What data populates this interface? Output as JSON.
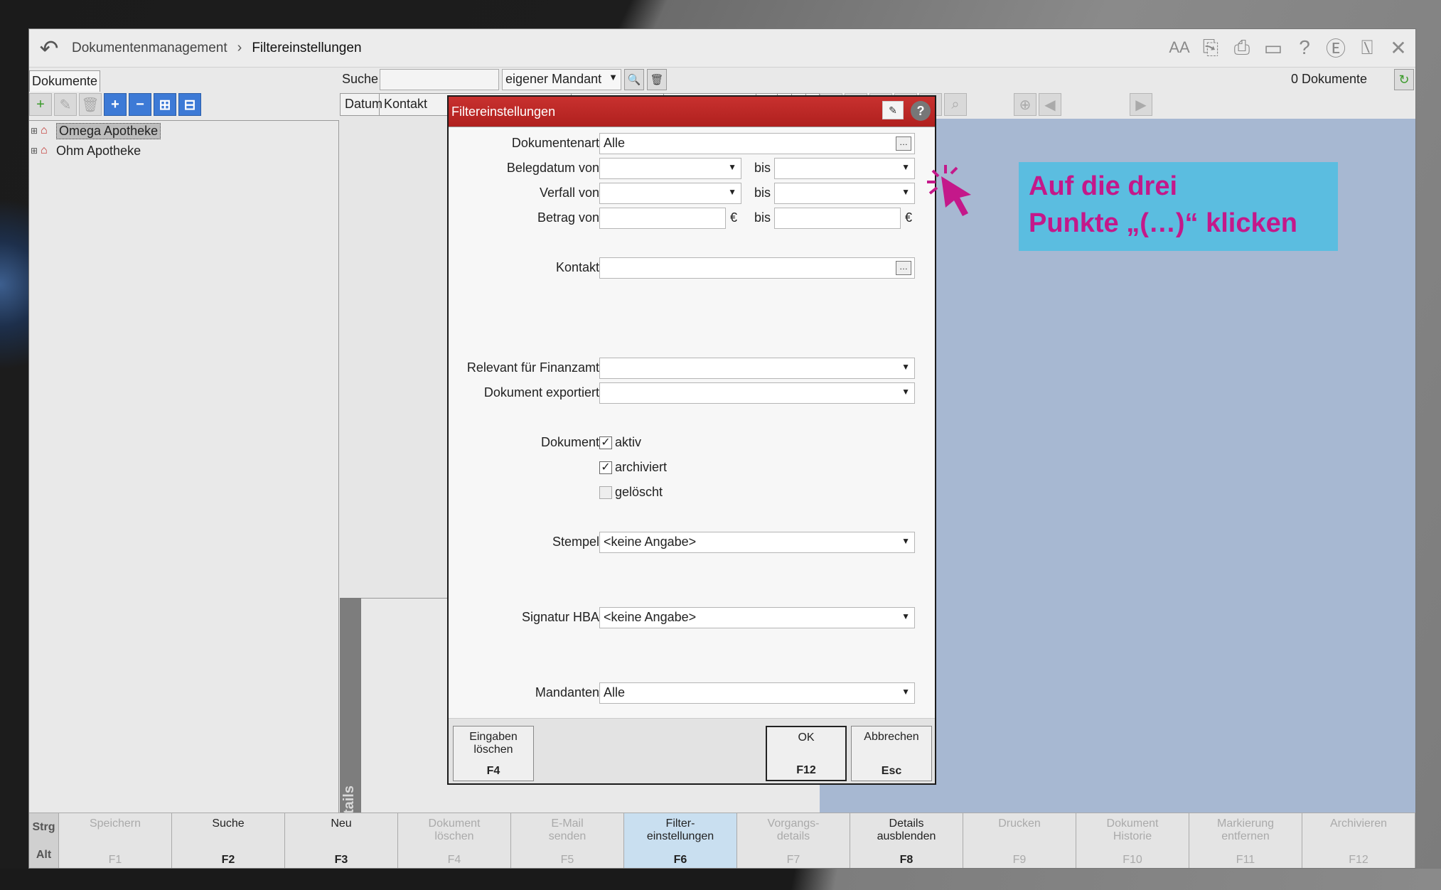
{
  "breadcrumb": {
    "section": "Dokumentenmanagement",
    "separator": "›",
    "page": "Filtereinstellungen"
  },
  "title_icons": [
    "AA",
    "copy-icon",
    "print-icon",
    "monitor-icon",
    "?",
    "e",
    "export-icon",
    "✕"
  ],
  "left": {
    "tab": "Dokumente",
    "tree": [
      {
        "label": "Omega Apotheke",
        "selected": true
      },
      {
        "label": "Ohm Apotheke",
        "selected": false
      }
    ]
  },
  "search": {
    "label": "Suche",
    "value": "",
    "mandant": "eigener Mandant"
  },
  "doc_count": "0 Dokumente",
  "grid": {
    "col_datum": "Datum",
    "col_kontakt": "Kontakt"
  },
  "details_label": "Details",
  "dialog": {
    "title": "Filtereinstellungen",
    "fields": {
      "dokumentenart_label": "Dokumentenart",
      "dokumentenart_value": "Alle",
      "belegdatum_label": "Belegdatum von",
      "bis": "bis",
      "verfall_label": "Verfall von",
      "betrag_label": "Betrag von",
      "euro": "€",
      "kontakt_label": "Kontakt",
      "kontakt_value": "",
      "finanzamt_label": "Relevant für Finanzamt",
      "exportiert_label": "Dokument exportiert",
      "dokument_label": "Dokument",
      "aktiv": "aktiv",
      "archiviert": "archiviert",
      "geloescht": "gelöscht",
      "stempel_label": "Stempel",
      "stempel_value": "<keine Angabe>",
      "signatur_label": "Signatur HBA",
      "signatur_value": "<keine Angabe>",
      "mandanten_label": "Mandanten",
      "mandanten_value": "Alle"
    },
    "checks": {
      "aktiv": true,
      "archiviert": true,
      "geloescht": false
    },
    "buttons": {
      "clear_l1": "Eingaben",
      "clear_l2": "löschen",
      "clear_key": "F4",
      "ok": "OK",
      "ok_key": "F12",
      "cancel": "Abbrechen",
      "cancel_key": "Esc"
    }
  },
  "annotation": {
    "line1": "Auf die drei",
    "line2": "Punkte „(…)“ klicken",
    "color": "#c4188a"
  },
  "fkeys": {
    "mod1": "Strg",
    "mod2": "Alt",
    "items": [
      {
        "l1": "Speichern",
        "l2": "",
        "key": "F1",
        "state": "dis"
      },
      {
        "l1": "Suche",
        "l2": "",
        "key": "F2",
        "state": "on"
      },
      {
        "l1": "Neu",
        "l2": "",
        "key": "F3",
        "state": "on"
      },
      {
        "l1": "Dokument",
        "l2": "löschen",
        "key": "F4",
        "state": "dis"
      },
      {
        "l1": "E-Mail",
        "l2": "senden",
        "key": "F5",
        "state": "dis"
      },
      {
        "l1": "Filter-",
        "l2": "einstellungen",
        "key": "F6",
        "state": "active"
      },
      {
        "l1": "Vorgangs-",
        "l2": "details",
        "key": "F7",
        "state": "dis"
      },
      {
        "l1": "Details",
        "l2": "ausblenden",
        "key": "F8",
        "state": "on"
      },
      {
        "l1": "Drucken",
        "l2": "",
        "key": "F9",
        "state": "dis"
      },
      {
        "l1": "Dokument",
        "l2": "Historie",
        "key": "F10",
        "state": "dis"
      },
      {
        "l1": "Markierung",
        "l2": "entfernen",
        "key": "F11",
        "state": "dis"
      },
      {
        "l1": "Archivieren",
        "l2": "",
        "key": "F12",
        "state": "dis"
      }
    ]
  },
  "colors": {
    "dialog_title": "#b0201e",
    "preview_bg": "#a7b8d2",
    "callout_bg": "#5bbde0"
  }
}
